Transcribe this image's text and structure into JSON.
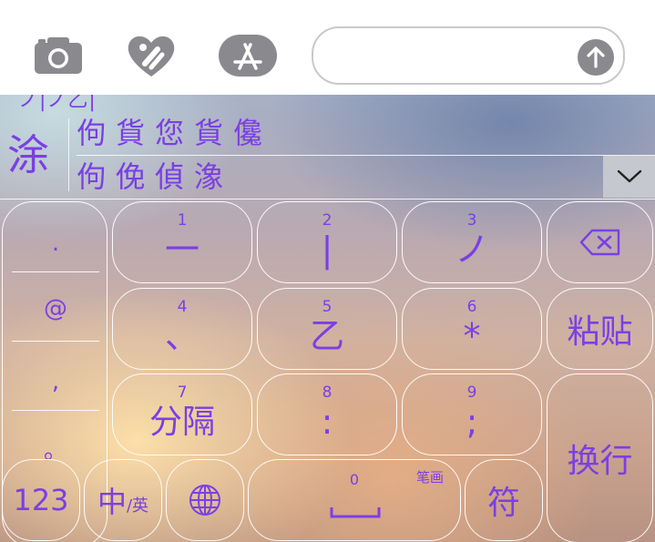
{
  "toolbar": {
    "icons": [
      "camera-icon",
      "heart-digital-touch-icon",
      "app-store-icon"
    ],
    "send_icon": "arrow-up-icon",
    "message_value": ""
  },
  "candidates": {
    "stroke_preview": "ノ|ノ乙|",
    "main": "涂",
    "row1": "佝貨您貨儳",
    "row2": "佝俛偵潒",
    "collapse_icon": "chevron-down-icon"
  },
  "punctuation": [
    ".",
    "@",
    ",",
    "。"
  ],
  "keys": {
    "k1": {
      "num": "1",
      "glyph": "一"
    },
    "k2": {
      "num": "2",
      "glyph": "|"
    },
    "k3": {
      "num": "3",
      "glyph": "ノ"
    },
    "k4": {
      "num": "4",
      "glyph": "、"
    },
    "k5": {
      "num": "5",
      "glyph": "乙"
    },
    "k6": {
      "num": "6",
      "glyph": "*"
    },
    "k7": {
      "num": "7",
      "glyph": "分隔"
    },
    "k8": {
      "num": "8",
      "glyph": ":"
    },
    "k9": {
      "num": "9",
      "glyph": ";"
    },
    "space": {
      "num": "0",
      "hint": "笔画",
      "glyph": "⎵"
    },
    "paste": "粘贴",
    "enter": "换行",
    "num_mode": "123",
    "lang_main": "中",
    "lang_sub": "/英",
    "symbol": "符",
    "globe_icon": "globe-icon",
    "delete_icon": "backspace-icon"
  },
  "colors": {
    "accent": "#7b3fe4"
  }
}
